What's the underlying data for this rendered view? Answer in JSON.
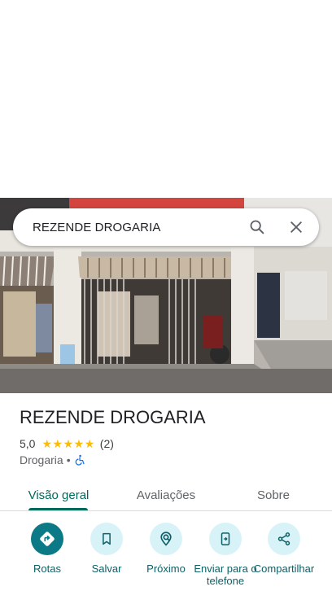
{
  "search": {
    "query": "REZENDE DROGARIA"
  },
  "photo": {
    "description_icon": "storefront-photo"
  },
  "place": {
    "name": "REZENDE DROGARIA",
    "rating": "5,0",
    "stars": "★★★★★",
    "review_count": "(2)",
    "category": "Drogaria",
    "separator": "•",
    "accessibility_icon": "wheelchair-icon"
  },
  "tabs": [
    {
      "label": "Visão geral",
      "active": true
    },
    {
      "label": "Avaliações",
      "active": false
    },
    {
      "label": "Sobre",
      "active": false
    }
  ],
  "actions": [
    {
      "label": "Rotas",
      "icon": "directions-icon"
    },
    {
      "label": "Salvar",
      "icon": "bookmark-icon"
    },
    {
      "label": "Próximo",
      "icon": "nearby-icon"
    },
    {
      "label": "Enviar para o telefone",
      "icon": "send-to-phone-icon"
    },
    {
      "label": "Compartilhar",
      "icon": "share-icon"
    }
  ],
  "colors": {
    "accent": "#00695c",
    "primary_button": "#0b7a86",
    "button_bg": "#d7f3f8",
    "star": "#fbbc04"
  }
}
